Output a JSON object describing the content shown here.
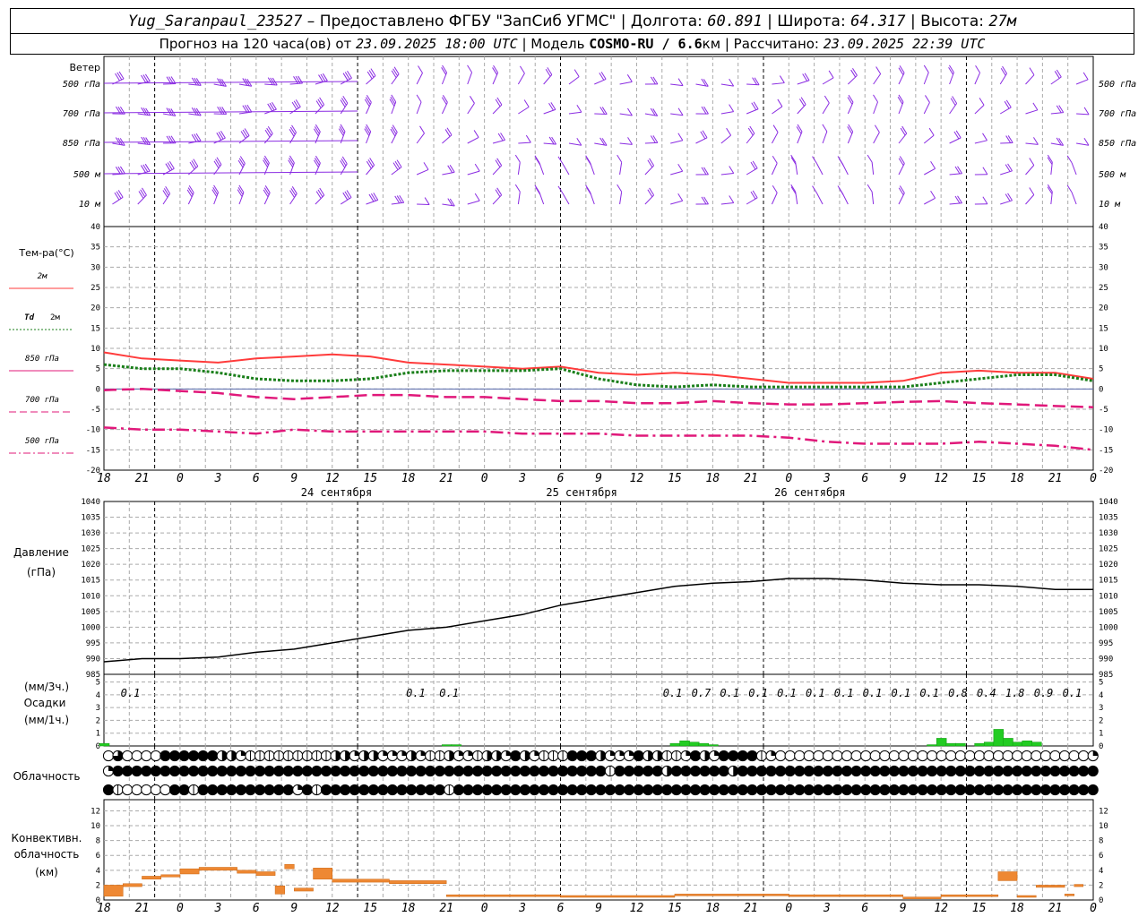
{
  "header": {
    "station": "Yug_Saranpaul_23527",
    "sep1": " – ",
    "provider": "Предоставлено ФГБУ \"ЗапСиб УГМС\"",
    "lon_label": "Долгота:",
    "lon": "60.891",
    "lat_label": "Широта:",
    "lat": "64.317",
    "alt_label": "Высота:",
    "alt": "27м",
    "forecast_label": "Прогноз на 120 часа(ов) от",
    "run_time": "23.09.2025 18:00 UTC",
    "model_label": "Модель",
    "model": "COSMO-RU / 6.6",
    "model_unit": "км",
    "calc_label": "Рассчитано:",
    "calc_time": "23.09.2025 22:39 UTC"
  },
  "panels": {
    "wind": {
      "title": "Ветер",
      "levels": [
        "500 гПа",
        "700 гПа",
        "850 гПа",
        "500 м",
        "10 м"
      ]
    },
    "temp": {
      "title": "Тем-ра(°C)",
      "legend": [
        {
          "label": "2м",
          "color": "#ff3b3b",
          "style": "solid"
        },
        {
          "label": "Td",
          "suffix": "2м",
          "color": "#1a7f1a",
          "style": "dotted"
        },
        {
          "label": "850 гПа",
          "color": "#e0187a",
          "style": "solid"
        },
        {
          "label": "700 гПа",
          "color": "#e0187a",
          "style": "dash"
        },
        {
          "label": "500 гПа",
          "color": "#e0187a",
          "style": "dashdot"
        }
      ],
      "yticks": [
        40,
        35,
        30,
        25,
        20,
        15,
        10,
        5,
        0,
        -5,
        -10,
        -15,
        -20
      ]
    },
    "pressure": {
      "title": "Давление",
      "unit": "(гПа)",
      "yticks": [
        1040,
        1035,
        1030,
        1025,
        1020,
        1015,
        1010,
        1005,
        1000,
        995,
        990,
        985
      ]
    },
    "precip": {
      "title_unit3": "(мм/3ч.)",
      "title": "Осадки",
      "title_unit1": "(мм/1ч.)",
      "yticks": [
        5,
        4,
        3,
        2,
        1,
        0
      ]
    },
    "cloud": {
      "title": "Облачность"
    },
    "conv": {
      "title1": "Конвективн.",
      "title2": "облачность",
      "unit": "(км)",
      "yticks": [
        12,
        10,
        8,
        6,
        4,
        2,
        0
      ]
    }
  },
  "time_axis": {
    "hour_labels": [
      "18",
      "21",
      "0",
      "3",
      "6",
      "9",
      "12",
      "15",
      "18",
      "21",
      "0",
      "3",
      "6",
      "9",
      "12",
      "15",
      "18",
      "21",
      "0",
      "3",
      "6",
      "9",
      "12",
      "15",
      "18",
      "21",
      "0"
    ],
    "date_labels": [
      "24 сентября",
      "25 сентября",
      "26 сентября"
    ]
  },
  "chart_data": {
    "type": "line",
    "x_hours": [
      0,
      3,
      6,
      9,
      12,
      15,
      18,
      21,
      24,
      27,
      30,
      33,
      36,
      39,
      42,
      45,
      48,
      51,
      54,
      57,
      60,
      63,
      66,
      69,
      72,
      75,
      78
    ],
    "series": [
      {
        "name": "2м",
        "values": [
          9,
          7.5,
          7,
          6.5,
          7.5,
          8,
          8.5,
          8,
          6.5,
          6,
          5.5,
          5,
          5.5,
          4,
          3.5,
          4,
          3.5,
          2.5,
          1.5,
          1.5,
          1.5,
          2,
          4,
          4.5,
          4,
          4,
          2.5
        ]
      },
      {
        "name": "Td 2м",
        "values": [
          6,
          5,
          5,
          4,
          2.5,
          2,
          2,
          2.5,
          4,
          4.5,
          4.5,
          4.5,
          5,
          2.5,
          1,
          0.5,
          1,
          0.5,
          0.5,
          0.5,
          0.5,
          0.5,
          1.5,
          2.5,
          3.5,
          3.5,
          2
        ]
      },
      {
        "name": "850 гПа",
        "values": [
          -0.3,
          0,
          -0.5,
          -1,
          -2,
          -2.5,
          -2,
          -1.5,
          -1.5,
          -2,
          -2,
          -2.5,
          -3,
          -3,
          -3.5,
          -3.5,
          -3,
          -3.5,
          -3.8,
          -3.8,
          -3.5,
          -3.2,
          -3,
          -3.5,
          -3.8,
          -4.2,
          -4.5
        ]
      },
      {
        "name": "700 гПа",
        "values": [
          -9.5,
          -10,
          -10,
          -10.5,
          -11,
          -10,
          -10.5,
          -10.5,
          -10.5,
          -10.5,
          -10.5,
          -11,
          -11,
          -11,
          -11.5,
          -11.5,
          -11.5,
          -11.5,
          -12,
          -13,
          -13.5,
          -13.5,
          -13.5,
          -13,
          -13.5,
          -14,
          -15
        ]
      },
      {
        "name": "Давление",
        "values": [
          989,
          990,
          990,
          990.5,
          992,
          993,
          995,
          997,
          999,
          1000,
          1002,
          1004,
          1007,
          1009,
          1011,
          1013,
          1014,
          1014.5,
          1015.5,
          1015.5,
          1015,
          1014,
          1013.5,
          1013.5,
          1013,
          1012,
          1012
        ]
      }
    ],
    "precip_3h_labels": [
      {
        "hour": 1,
        "value": "0.1"
      },
      {
        "hour": 31,
        "value": "0.1"
      },
      {
        "hour": 34.5,
        "value": "0.1"
      },
      {
        "hour": 58,
        "value": "0.1"
      },
      {
        "hour": 61,
        "value": "0.7"
      },
      {
        "hour": 64,
        "value": "0.1"
      },
      {
        "hour": 67,
        "value": "0.1"
      },
      {
        "hour": 70,
        "value": "0.1"
      },
      {
        "hour": 73,
        "value": "0.1"
      },
      {
        "hour": 76,
        "value": "0.1"
      },
      {
        "hour": 79,
        "value": "0.1"
      },
      {
        "hour": 82,
        "value": "0.1"
      },
      {
        "hour": 85,
        "value": "0.1"
      },
      {
        "hour": 88,
        "value": "0.8"
      },
      {
        "hour": 91,
        "value": "0.4"
      },
      {
        "hour": 94,
        "value": "1.8"
      },
      {
        "hour": 97,
        "value": "0.9"
      },
      {
        "hour": 100,
        "value": "0.1"
      }
    ],
    "precip_1h": [
      {
        "hour": 0,
        "value": 0.2
      },
      {
        "hour": 36,
        "value": 0.1
      },
      {
        "hour": 37,
        "value": 0.1
      },
      {
        "hour": 60,
        "value": 0.2
      },
      {
        "hour": 61,
        "value": 0.4
      },
      {
        "hour": 62,
        "value": 0.3
      },
      {
        "hour": 63,
        "value": 0.2
      },
      {
        "hour": 64,
        "value": 0.1
      },
      {
        "hour": 87,
        "value": 0.1
      },
      {
        "hour": 88,
        "value": 0.6
      },
      {
        "hour": 89,
        "value": 0.2
      },
      {
        "hour": 90,
        "value": 0.2
      },
      {
        "hour": 92,
        "value": 0.2
      },
      {
        "hour": 93,
        "value": 0.3
      },
      {
        "hour": 94,
        "value": 1.3
      },
      {
        "hour": 95,
        "value": 0.6
      },
      {
        "hour": 96,
        "value": 0.3
      },
      {
        "hour": 97,
        "value": 0.4
      },
      {
        "hour": 98,
        "value": 0.3
      }
    ],
    "conv_cloud": [
      {
        "hour": 0,
        "base": 0.5,
        "top": 2
      },
      {
        "hour": 2,
        "base": 1.8,
        "top": 2.2
      },
      {
        "hour": 4,
        "base": 2.8,
        "top": 3.2
      },
      {
        "hour": 6,
        "base": 3.1,
        "top": 3.4
      },
      {
        "hour": 8,
        "base": 3.5,
        "top": 4.2
      },
      {
        "hour": 10,
        "base": 4,
        "top": 4.4
      },
      {
        "hour": 14,
        "base": 3.6,
        "top": 4
      },
      {
        "hour": 16,
        "base": 3.3,
        "top": 3.8
      },
      {
        "hour": 18,
        "base": 0.8,
        "top": 1.9
      },
      {
        "hour": 19,
        "base": 4.2,
        "top": 4.8
      },
      {
        "hour": 20,
        "base": 1.2,
        "top": 1.6
      },
      {
        "hour": 22,
        "base": 2.8,
        "top": 4.3
      },
      {
        "hour": 24,
        "base": 2.4,
        "top": 2.8
      },
      {
        "hour": 30,
        "base": 2.2,
        "top": 2.6
      },
      {
        "hour": 36,
        "base": 0.5,
        "top": 0.7
      },
      {
        "hour": 48,
        "base": 0.5,
        "top": 0.6
      },
      {
        "hour": 60,
        "base": 0.6,
        "top": 0.8
      },
      {
        "hour": 72,
        "base": 0.5,
        "top": 0.7
      },
      {
        "hour": 84,
        "base": 0.2,
        "top": 0.4
      },
      {
        "hour": 88,
        "base": 0.5,
        "top": 0.7
      },
      {
        "hour": 94,
        "base": 2.6,
        "top": 3.8
      },
      {
        "hour": 96,
        "base": 0.5,
        "top": 0.6
      },
      {
        "hour": 98,
        "base": 1.7,
        "top": 2
      },
      {
        "hour": 101,
        "base": 0.6,
        "top": 0.8
      },
      {
        "hour": 102,
        "base": 1.8,
        "top": 2.1
      }
    ]
  }
}
